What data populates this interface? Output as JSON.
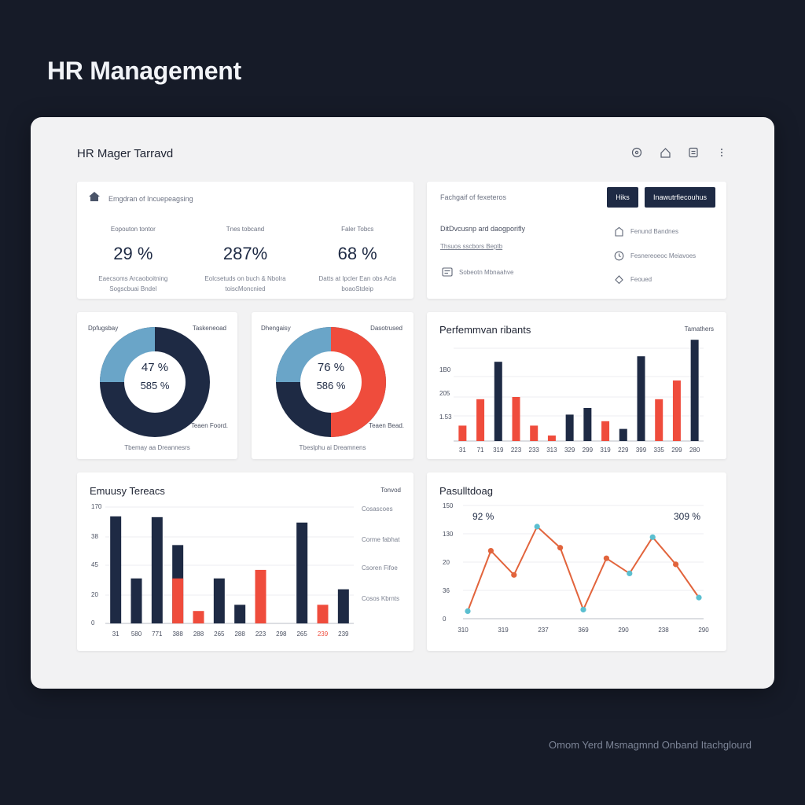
{
  "page_title": "HR Management",
  "footer_caption": "Omom Yerd Msmagmnd Onband Itachglourd",
  "window": {
    "title": "HR Mager Tarravd",
    "icons": [
      "settings-icon",
      "home-icon",
      "document-icon",
      "more-icon"
    ]
  },
  "kpi_card": {
    "header": "Emgdran of Incuepeagsing",
    "header_icon": "home-icon",
    "items": [
      {
        "label": "Eopouton tontor",
        "value": "29 %",
        "desc": "Eaecsoms Arcaoboitning Sogscbuai Bndel"
      },
      {
        "label": "Tnes tobcand",
        "value": "287%",
        "desc": "Eolcsetuds on buch & Nbolra toiscMoncnied"
      },
      {
        "label": "Faler Tobcs",
        "value": "68 %",
        "desc": "Datts at Ipcler Ean obs Acla boaoStdeip"
      }
    ]
  },
  "info_card": {
    "header": "Fachgaif of fexeteros",
    "btn_primary": "Hiks",
    "btn_secondary": "Inawutrfiecouhus",
    "subtitle": "DitDvcusnp ard daogporifly",
    "subtitle2": "Thsuos sscbors Beptb",
    "left_item": "Sobeotn Mbnaahve",
    "right_items": [
      {
        "icon": "user-icon",
        "label": "Fenund Bandnes"
      },
      {
        "icon": "clock-icon",
        "label": "Fesnereoeoc Meiavoes"
      },
      {
        "icon": "location-icon",
        "label": "Feoued"
      }
    ]
  },
  "donut1": {
    "top_left": "Dpfugsbay",
    "top_right": "Taskeneoad",
    "bottom_right": "Teaen Foord.",
    "caption": "Tbemay aa Dreannesrs",
    "value1": "47 %",
    "value2": "585 %",
    "segment_fraction": 0.25,
    "color_main": "#1e2a44",
    "color_accent": "#6aa5c8"
  },
  "donut2": {
    "top_left": "Dhengaisy",
    "top_right": "Dasotrused",
    "bottom_right": "Teaen Bead.",
    "caption": "Tbeslphu ai Dreamnens",
    "value1": "76 %",
    "value2": "586 %",
    "segment_fraction": 0.25,
    "red_fraction": 0.5,
    "color_main": "#1e2a44",
    "color_accent": "#6aa5c8",
    "color_red": "#ef4c3c"
  },
  "chart_data": [
    {
      "type": "bar",
      "title": "Perfemmvan ribants",
      "legend_label": "Tamathers",
      "y_tick_labels": [
        "1B0",
        "205",
        "1.53"
      ],
      "categories": [
        "31",
        "71",
        "319",
        "223",
        "233",
        "313",
        "329",
        "299",
        "319",
        "229",
        "399",
        "335",
        "299",
        "280"
      ],
      "series": [
        {
          "color": "#ef4c3c",
          "values": [
            14,
            38,
            0,
            40,
            14,
            5,
            0,
            0,
            18,
            0,
            0,
            38,
            55,
            0
          ]
        },
        {
          "color": "#1e2a44",
          "values": [
            0,
            0,
            72,
            0,
            0,
            0,
            24,
            30,
            0,
            11,
            77,
            0,
            0,
            92
          ]
        }
      ],
      "tall_bar_value": 100,
      "ylim": [
        0,
        100
      ]
    },
    {
      "type": "bar",
      "title": "Emuusy Tereacs",
      "y_tick_labels": [
        "170",
        "38",
        "45",
        "20",
        "0"
      ],
      "legend_label": "Tonvod",
      "legend_items": [
        "Cosascoes",
        "Corme fabhat",
        "Csoren Fifoe",
        "Cosos Kbrnts"
      ],
      "categories": [
        "31",
        "580",
        "771",
        "388",
        "288",
        "265",
        "288",
        "223",
        "298",
        "265",
        "239",
        "239"
      ],
      "series": [
        {
          "name": "",
          "color": "#1e2a44",
          "values": [
            138,
            58,
            137,
            101,
            0,
            58,
            24,
            0,
            0,
            130,
            0,
            44
          ]
        },
        {
          "name": "",
          "color": "#ef4c3c",
          "values": [
            0,
            0,
            0,
            58,
            16,
            0,
            0,
            69,
            0,
            0,
            24,
            0
          ]
        }
      ],
      "ylim": [
        0,
        150
      ]
    },
    {
      "type": "line",
      "title": "Pasulltdoag",
      "y_tick_labels": [
        "150",
        "130",
        "20",
        "36",
        "0"
      ],
      "x_tick_labels": [
        "310",
        "319",
        "237",
        "369",
        "290",
        "238",
        "290"
      ],
      "annotations": [
        "92 %",
        "309 %"
      ],
      "values": [
        10,
        90,
        58,
        122,
        94,
        12,
        80,
        60,
        108,
        72,
        28
      ],
      "ylim": [
        0,
        150
      ],
      "line_color": "#e2643c",
      "point_colors": [
        "#5bbfd0",
        "#e2643c",
        "#e2643c",
        "#5bbfd0",
        "#e2643c",
        "#5bbfd0",
        "#e2643c",
        "#5bbfd0",
        "#5bbfd0",
        "#e2643c",
        "#5bbfd0"
      ]
    }
  ]
}
